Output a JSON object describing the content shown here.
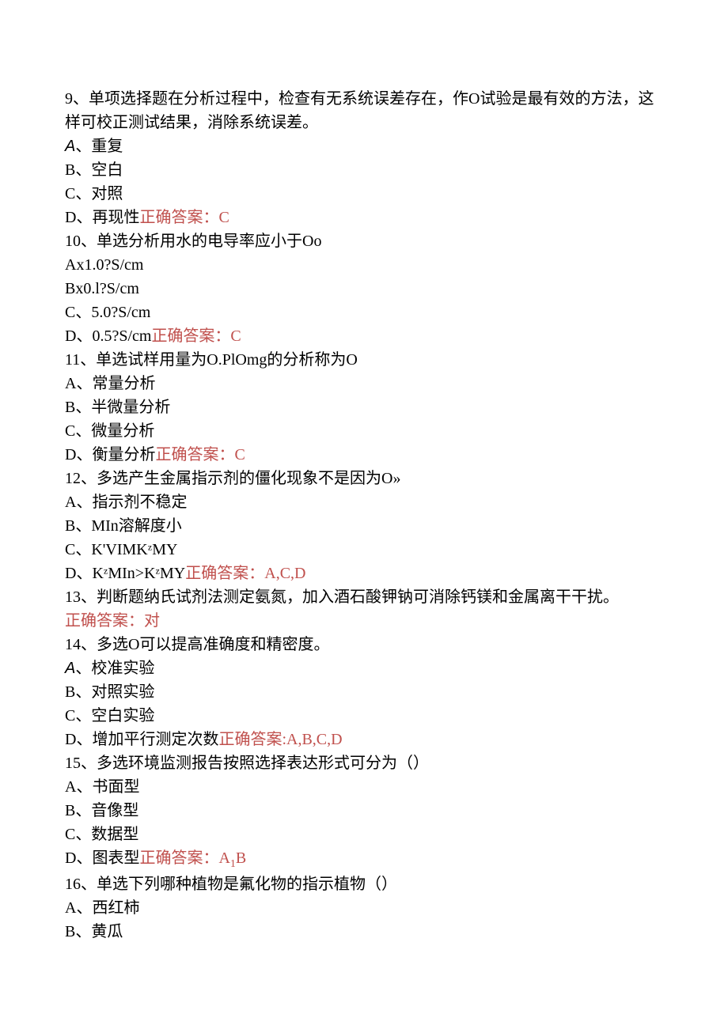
{
  "q9": {
    "prompt": "9、单项选择题在分析过程中，检查有无系统误差存在，作O试验是最有效的方法，这样可校正测试结果，消除系统误差。",
    "optA_prefix": "A",
    "optA_text": "、重复",
    "optB": "B、空白",
    "optC": "C、对照",
    "optD_text": "D、再现性",
    "answer_label": "正确答案：C"
  },
  "q10": {
    "prompt": "10、单选分析用水的电导率应小于Oo",
    "optA": "Ax1.0?S/cm",
    "optB": "Bx0.l?S/cm",
    "optC": "C、5.0?S/cm",
    "optD_text": "D、0.5?S/cm",
    "answer_label": "正确答案：C"
  },
  "q11": {
    "prompt": "11、单选试样用量为O.PlOmg的分析称为O",
    "optA": "A、常量分析",
    "optB": "B、半微量分析",
    "optC": "C、微量分析",
    "optD_text": "D、衡量分析",
    "answer_label": "正确答案：C"
  },
  "q12": {
    "prompt": "12、多选产生金属指示剂的僵化现象不是因为O»",
    "optA": "A、指示剂不稳定",
    "optB": "B、MIn溶解度小",
    "optC": "C、K'VIMKᶻMY",
    "optD_text": "D、KᶻMIn>KᶻMY",
    "answer_label": "正确答案：A,C,D"
  },
  "q13": {
    "prompt": "13、判断题纳氏试剂法测定氨氮，加入酒石酸钾钠可消除钙镁和金属离干干扰。",
    "answer_label": "正确答案：对"
  },
  "q14": {
    "prompt": "14、多选O可以提高准确度和精密度。",
    "optA_prefix": "A",
    "optA_text": "、校准实验",
    "optB": "B、对照实验",
    "optC": "C、空白实验",
    "optD_text": "D、增加平行测定次数",
    "answer_label": "正确答案:A,B,C,D"
  },
  "q15": {
    "prompt": "15、多选环境监测报告按照选择表达形式可分为（）",
    "optA": "A、书面型",
    "optB": "B、音像型",
    "optC": "C、数据型",
    "optD_text": "D、图表型",
    "answer_label": "正确答案：A",
    "answer_sub": "1",
    "answer_tail": "B"
  },
  "q16": {
    "prompt": "16、单选下列哪种植物是氟化物的指示植物（）",
    "optA": "A、西红柿",
    "optB": "B、黄瓜"
  }
}
